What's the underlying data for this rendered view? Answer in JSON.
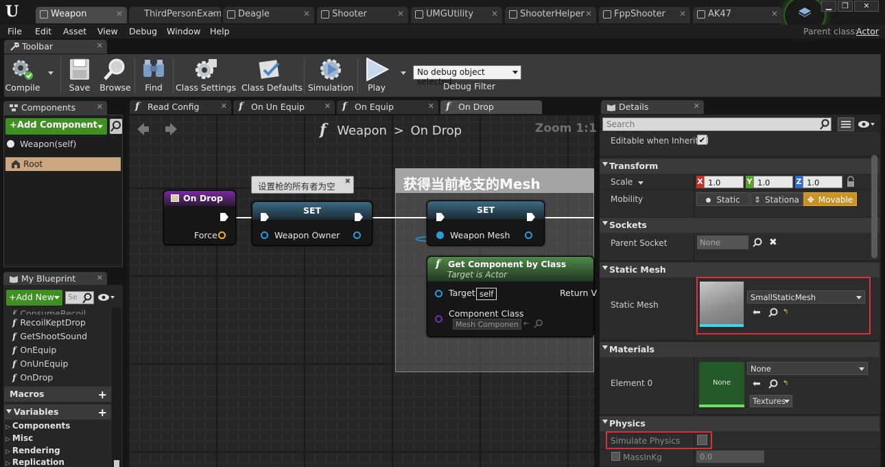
{
  "window": {
    "tabs": [
      "Weapon",
      "ThirdPersonExamp",
      "Deagle",
      "Shooter",
      "UMGUtility",
      "ShooterHelper",
      "FppShooter",
      "AK47"
    ],
    "active_tab": "Weapon",
    "logo": "U"
  },
  "menu": {
    "items": [
      "File",
      "Edit",
      "Asset",
      "View",
      "Debug",
      "Window",
      "Help"
    ],
    "parent_class_label": "Parent class:",
    "parent_class_value": "Actor"
  },
  "toolbar": {
    "tab_label": "Toolbar",
    "buttons": [
      "Compile",
      "Save",
      "Browse",
      "Find",
      "Class Settings",
      "Class Defaults",
      "Simulation",
      "Play"
    ],
    "debug_selected": "No debug object selected",
    "debug_filter_label": "Debug Filter"
  },
  "components": {
    "tab_label": "Components",
    "add_button": "+Add Component",
    "self_item": "Weapon(self)",
    "root_item": "Root"
  },
  "my_blueprint": {
    "tab_label": "My Blueprint",
    "add_new": "+Add New",
    "search_placeholder": "Se",
    "functions": [
      "ConsumeRecoil",
      "RecoilKeptDrop",
      "GetShootSound",
      "OnEquip",
      "OnUnEquip",
      "OnDrop"
    ],
    "macros_label": "Macros",
    "variables_label": "Variables",
    "variable_categories": [
      "Components",
      "Misc",
      "Rendering",
      "Replication"
    ]
  },
  "graph_tabs": [
    "Read Config",
    "On Un Equip",
    "On Equip",
    "On Drop"
  ],
  "graph": {
    "breadcrumb_root": "Weapon",
    "breadcrumb_sep": ">",
    "breadcrumb_leaf": "On Drop",
    "zoom": "Zoom 1:1",
    "comment_title": "获得当前枪支的Mesh",
    "tooltip_text": "设置枪的所有者为空",
    "on_drop_node": {
      "title": "On Drop",
      "pin": "Force"
    },
    "set_node_1": {
      "title": "SET",
      "pin": "Weapon Owner"
    },
    "set_node_2": {
      "title": "SET",
      "pin": "Weapon Mesh"
    },
    "get_component_node": {
      "title": "Get Component by Class",
      "subtitle": "Target is Actor",
      "target_pin": "Target",
      "target_value": "self",
      "class_pin": "Component Class",
      "class_value": "Mesh Componen",
      "return_pin": "Return V"
    }
  },
  "details": {
    "tab_label": "Details",
    "search_placeholder": "Search",
    "editable_when_inherited": "Editable when Inherited",
    "transform": {
      "title": "Transform",
      "scale_label": "Scale",
      "axes": [
        "X",
        "Y",
        "Z"
      ],
      "scale_values": [
        "1.0",
        "1.0",
        "1.0"
      ],
      "mobility_label": "Mobility",
      "mobility_options": [
        "Static",
        "Stationa",
        "Movable"
      ],
      "mobility_selected": "Movable"
    },
    "sockets": {
      "title": "Sockets",
      "parent_socket_label": "Parent Socket",
      "parent_socket_value": "None"
    },
    "static_mesh": {
      "title": "Static Mesh",
      "label": "Static Mesh",
      "value": "SmallStaticMesh"
    },
    "materials": {
      "title": "Materials",
      "element_label": "Element 0",
      "element_value": "None",
      "thumb_text": "None",
      "textures_label": "Textures"
    },
    "physics": {
      "title": "Physics",
      "simulate_physics": "Simulate Physics",
      "mass_label": "MassInKg",
      "mass_value": "0.0"
    }
  },
  "colors": {
    "accent_green": "#3f8f23",
    "movable_orange": "#c99225",
    "highlight_red": "#d3343c",
    "axis_x": "#c8302a",
    "axis_y": "#5aa02a",
    "axis_z": "#2f6ed0"
  }
}
